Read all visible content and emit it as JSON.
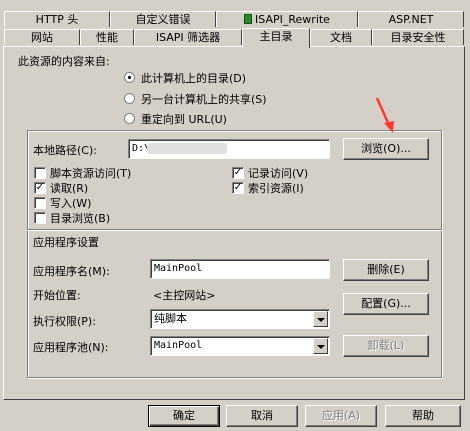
{
  "tabs_row1": [
    "HTTP 头",
    "自定义错误",
    "ISAPI_Rewrite",
    "ASP.NET"
  ],
  "tabs_row2": [
    "网站",
    "性能",
    "ISAPI 筛选器",
    "主目录",
    "文档",
    "目录安全性"
  ],
  "source": {
    "heading": "此资源的内容来自:",
    "options": [
      "此计算机上的目录(D)",
      "另一台计算机上的共享(S)",
      "重定向到 URL(U)"
    ],
    "selected": 0
  },
  "local_path": {
    "label": "本地路径(C):",
    "value": "D:\\",
    "browse_label": "浏览(O)..."
  },
  "perm_checks": [
    {
      "label": "脚本资源访问(T)",
      "checked": false
    },
    {
      "label": "读取(R)",
      "checked": true
    },
    {
      "label": "写入(W)",
      "checked": false
    },
    {
      "label": "目录浏览(B)",
      "checked": false
    }
  ],
  "log_checks": [
    {
      "label": "记录访问(V)",
      "checked": true
    },
    {
      "label": "索引资源(I)",
      "checked": true
    }
  ],
  "app": {
    "section_title": "应用程序设置",
    "name_label": "应用程序名(M):",
    "name_value": "MainPool",
    "remove_label": "删除(E)",
    "start_label": "开始位置:",
    "start_value": "<主控网站>",
    "config_label": "配置(G)...",
    "exec_label": "执行权限(P):",
    "exec_value": "纯脚本",
    "pool_label": "应用程序池(N):",
    "pool_value": "MainPool",
    "unload_label": "卸载(L)"
  },
  "footer": {
    "ok": "确定",
    "cancel": "取消",
    "apply": "应用(A)",
    "help": "帮助"
  },
  "colors": {
    "face": "#d4d0c8",
    "annotation_arrow": "#ff3b30"
  }
}
